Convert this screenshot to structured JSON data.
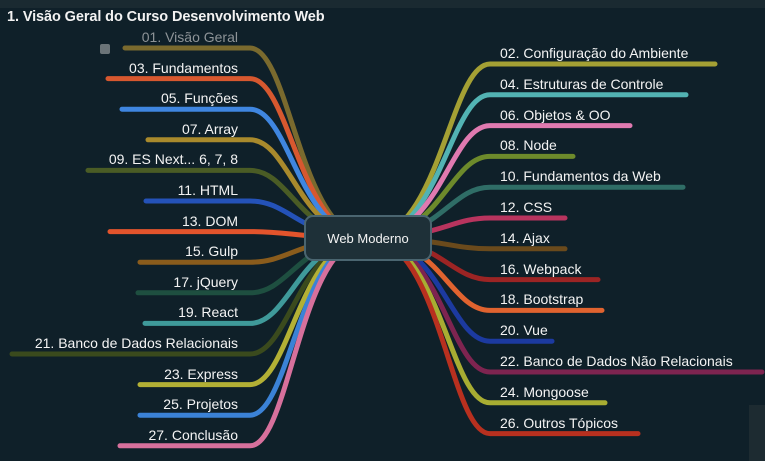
{
  "title": "1. Visão Geral do Curso Desenvolvimento Web",
  "center": "Web Moderno",
  "colors": {
    "background": "#0f2029",
    "center_border": "#4a6570",
    "center_fill": "#1e3038"
  },
  "left_nodes": [
    {
      "label": "01. Visão Geral",
      "color": "#7a6a2e",
      "faded": true
    },
    {
      "label": "03. Fundamentos",
      "color": "#d7582f"
    },
    {
      "label": "05. Funções",
      "color": "#3f86e0"
    },
    {
      "label": "07. Array",
      "color": "#a98a2c"
    },
    {
      "label": "09. ES Next... 6, 7, 8",
      "color": "#4a5c25"
    },
    {
      "label": "11. HTML",
      "color": "#2452b8"
    },
    {
      "label": "13. DOM",
      "color": "#e3542c"
    },
    {
      "label": "15. Gulp",
      "color": "#8a5c1c"
    },
    {
      "label": "17. jQuery",
      "color": "#1e4f40"
    },
    {
      "label": "19. React",
      "color": "#3f9a9a"
    },
    {
      "label": "21. Banco de Dados Relacionais",
      "color": "#3a4a1d"
    },
    {
      "label": "23. Express",
      "color": "#b3b035"
    },
    {
      "label": "25. Projetos",
      "color": "#3b82d6"
    },
    {
      "label": "27. Conclusão",
      "color": "#d7709c"
    }
  ],
  "right_nodes": [
    {
      "label": "02. Configuração do Ambiente",
      "color": "#a4a034"
    },
    {
      "label": "04. Estruturas de Controle",
      "color": "#52b3b3"
    },
    {
      "label": "06. Objetos & OO",
      "color": "#e07ab0"
    },
    {
      "label": "08. Node",
      "color": "#6d8a2b"
    },
    {
      "label": "10. Fundamentos da Web",
      "color": "#2f6d66"
    },
    {
      "label": "12. CSS",
      "color": "#b8345e"
    },
    {
      "label": "14. Ajax",
      "color": "#6a4a1c"
    },
    {
      "label": "16. Webpack",
      "color": "#9c2424"
    },
    {
      "label": "18. Bootstrap",
      "color": "#e0632f"
    },
    {
      "label": "20. Vue",
      "color": "#1c3aa0"
    },
    {
      "label": "22. Banco de Dados Não Relacionais",
      "color": "#7e2450"
    },
    {
      "label": "24. Mongoose",
      "color": "#a8ad32"
    },
    {
      "label": "26. Outros Tópicos",
      "color": "#b8301f"
    }
  ]
}
